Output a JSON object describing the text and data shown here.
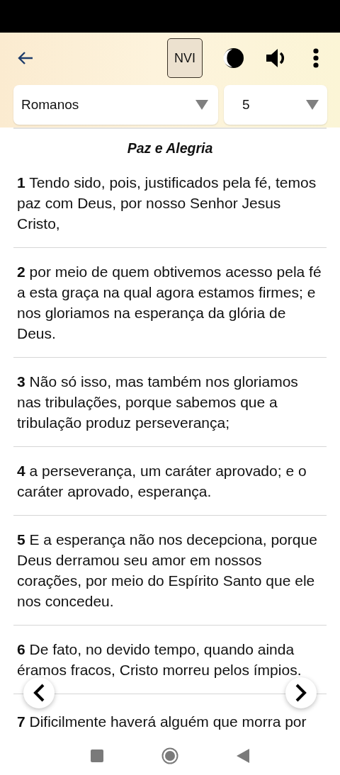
{
  "toolbar": {
    "version": "NVI"
  },
  "selectors": {
    "book": "Romanos",
    "chapter": "5"
  },
  "heading": "Paz e Alegria",
  "verses": [
    {
      "number": "1",
      "text": "Tendo sido, pois, justificados pela fé, temos paz com Deus, por nosso Senhor Jesus Cristo,"
    },
    {
      "number": "2",
      "text": "por meio de quem obtivemos acesso pela fé a esta graça na qual agora estamos firmes; e nos gloriamos na esperança da glória de Deus."
    },
    {
      "number": "3",
      "text": "Não só isso, mas também nos gloriamos nas tribulações, porque sabemos que a tribulação produz perseverança;"
    },
    {
      "number": "4",
      "text": "a perseverança, um caráter aprovado; e o caráter aprovado, esperança."
    },
    {
      "number": "5",
      "text": "E a esperança não nos decepciona, porque Deus derramou seu amor em nossos corações, por meio do Espírito Santo que ele nos concedeu."
    },
    {
      "number": "6",
      "text": "De fato, no devido tempo, quando ainda éramos fracos, Cristo morreu pelos ímpios."
    },
    {
      "number": "7",
      "text": "Dificilmente haverá alguém que morra por"
    }
  ]
}
